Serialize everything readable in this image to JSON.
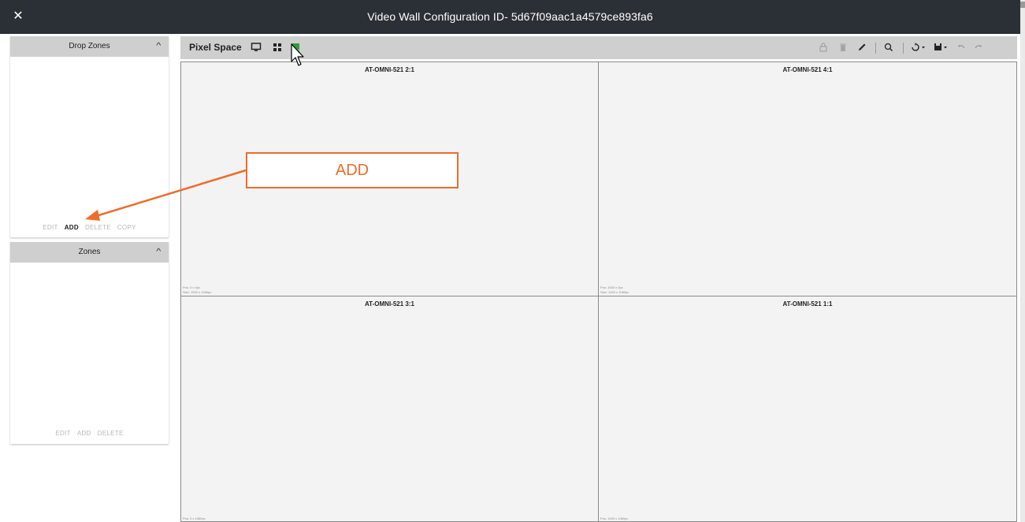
{
  "window": {
    "title": "Video Wall Configuration ID- 5d67f09aac1a4579ce893fa6",
    "close_glyph": "✕"
  },
  "drop_zones_panel": {
    "title": "Drop Zones",
    "chevron_icon": "chevron-up-icon",
    "actions": [
      {
        "label": "EDIT",
        "active": false
      },
      {
        "label": "ADD",
        "active": true
      },
      {
        "label": "DELETE",
        "active": false
      },
      {
        "label": "COPY",
        "active": false
      }
    ]
  },
  "zones_panel": {
    "title": "Zones",
    "chevron_icon": "chevron-up-icon",
    "actions": [
      {
        "label": "EDIT",
        "active": false
      },
      {
        "label": "ADD",
        "active": false
      },
      {
        "label": "DELETE",
        "active": false
      }
    ]
  },
  "toolbar": {
    "label": "Pixel Space",
    "left_icons": [
      "monitor-icon",
      "grid-icon",
      "green-zone-icon"
    ],
    "right_icons": [
      "lock-icon",
      "trash-icon",
      "pencil-icon",
      "zoom-icon",
      "refresh-dropdown-icon",
      "save-dropdown-icon",
      "undo-icon",
      "redo-icon"
    ],
    "accent_color": "#2e9e3a"
  },
  "screens": [
    {
      "name": "AT-OMNI-521 2:1",
      "pos": "Pos: 0 x 0px",
      "size": "Size: 1920 x 1080px"
    },
    {
      "name": "AT-OMNI-521 4:1",
      "pos": "Pos: 1920 x 0px",
      "size": "Size: 1920 x 1080px"
    },
    {
      "name": "AT-OMNI-521 3:1",
      "pos": "Pos: 0 x 1080px",
      "size": ""
    },
    {
      "name": "AT-OMNI-521 1:1",
      "pos": "Pos: 1920 x 1080px",
      "size": ""
    }
  ],
  "callout": {
    "text": "ADD",
    "color": "#ee6c2c"
  }
}
